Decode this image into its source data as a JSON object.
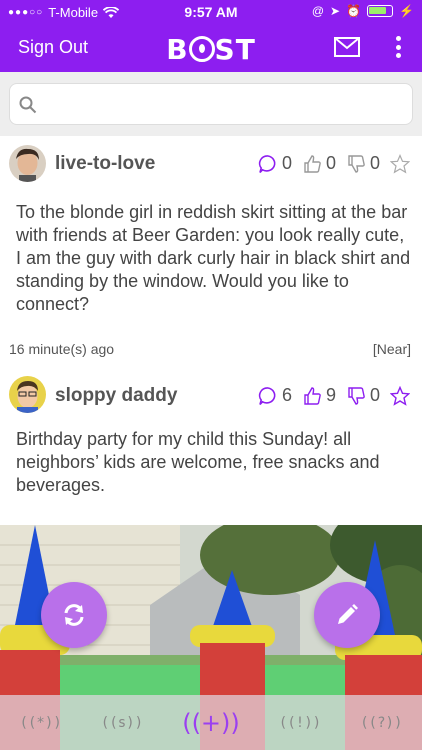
{
  "status_bar": {
    "carrier": "T-Mobile",
    "time": "9:57 AM"
  },
  "header": {
    "sign_out_label": "Sign Out",
    "logo_text": "B",
    "logo_suffix": "ST",
    "mail_icon": "mail-icon",
    "more_icon": "more-vertical-icon"
  },
  "search": {
    "placeholder": "",
    "icon": "search-icon"
  },
  "posts": [
    {
      "username": "live-to-love",
      "comments": "0",
      "likes": "0",
      "dislikes": "0",
      "text": "To the blonde girl in reddish skirt sitting at the bar with friends at Beer Garden: you look really cute, I am the guy with dark curly hair in black shirt and standing by the window. Would you like to connect?",
      "time_ago": "16 minute(s) ago",
      "distance": "[Near]"
    },
    {
      "username": "sloppy daddy",
      "comments": "6",
      "likes": "9",
      "dislikes": "0",
      "text": "Birthday party for my child this Sunday! all neighbors’ kids are welcome, free snacks and beverages."
    }
  ],
  "tabs": [
    {
      "label": "((*))",
      "active": false
    },
    {
      "label": "((s))",
      "active": false
    },
    {
      "label": "((+))",
      "active": true
    },
    {
      "label": "((!))",
      "active": false
    },
    {
      "label": "((?))",
      "active": false
    }
  ],
  "colors": {
    "brand": "#8d1ef0",
    "accent": "#9b3ff0",
    "fab": "#b970ea"
  }
}
